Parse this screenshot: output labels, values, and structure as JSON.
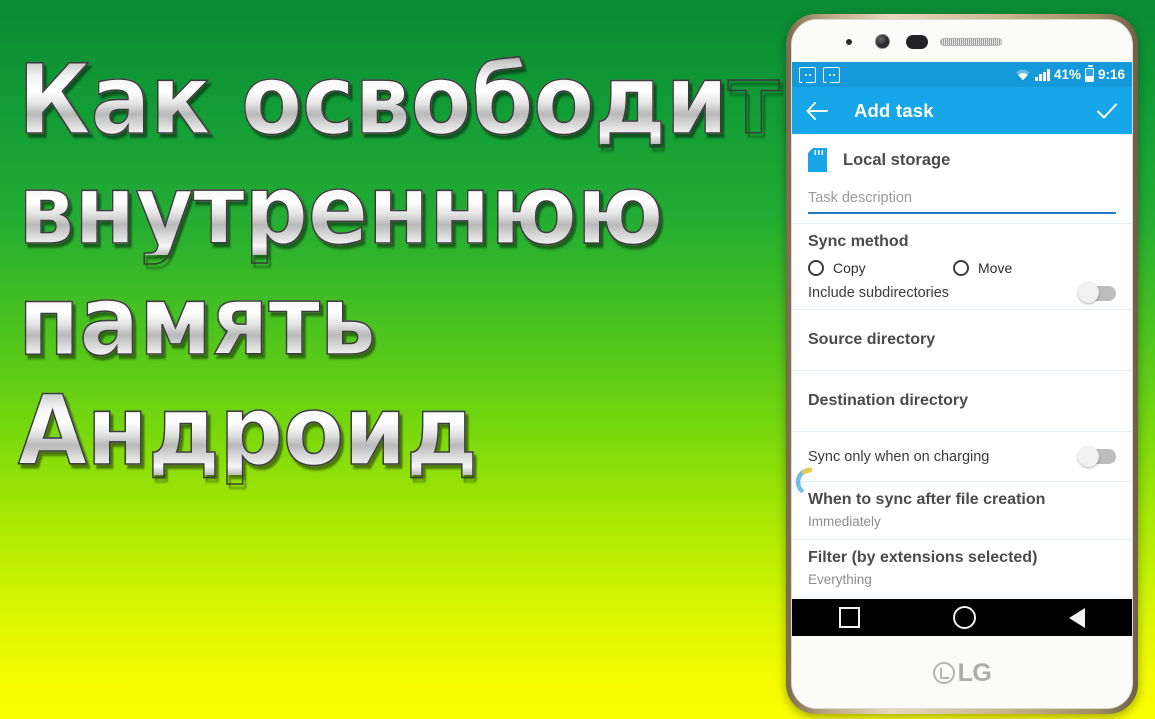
{
  "background": {
    "gradient_top": "#0a8a33",
    "gradient_mid": "#6fd411",
    "gradient_bottom": "#fbff00"
  },
  "title": {
    "lines": [
      "Как освободить",
      "внутреннюю",
      "память",
      "Андроид"
    ],
    "full_text": "Как освободить внутреннюю память Андроид"
  },
  "phone": {
    "brand": "LG",
    "bezel_color": "#cbb793",
    "hardware": {
      "sensor": "proximity-sensor",
      "camera": "front-camera",
      "ir": "ir-blaster",
      "speaker": "earpiece-speaker"
    }
  },
  "status_bar": {
    "background": "#1499DB",
    "notifications": [
      "notification-icon",
      "notification-icon"
    ],
    "wifi": "wifi-icon",
    "signal": "signal-icon",
    "battery_percent": "41%",
    "battery": "battery-icon",
    "time": "9:16"
  },
  "app_bar": {
    "background": "#17A6E8",
    "back_icon": "back-arrow-icon",
    "title": "Add task",
    "confirm_icon": "check-icon"
  },
  "content": {
    "storage": {
      "icon": "sd-card-icon",
      "icon_color": "#17A6E8",
      "label": "Local storage"
    },
    "task_description": {
      "value": "",
      "placeholder": "Task description",
      "underline_color": "#1f7fc4"
    },
    "sync_method": {
      "title": "Sync method",
      "options": [
        {
          "label": "Copy",
          "selected": false
        },
        {
          "label": "Move",
          "selected": false
        }
      ],
      "include_subdirectories": {
        "label": "Include subdirectories",
        "enabled": false
      }
    },
    "source_directory": {
      "title": "Source directory",
      "value": ""
    },
    "destination_directory": {
      "title": "Destination directory",
      "value": ""
    },
    "sync_when_charging": {
      "label": "Sync only when on charging",
      "enabled": false
    },
    "when_to_sync": {
      "title": "When to sync after file creation",
      "value": "Immediately"
    },
    "filter": {
      "title": "Filter (by extensions selected)",
      "value": "Everything"
    }
  },
  "nav_bar": {
    "background": "#000000",
    "buttons": [
      "recents-button",
      "home-button",
      "back-button"
    ]
  }
}
